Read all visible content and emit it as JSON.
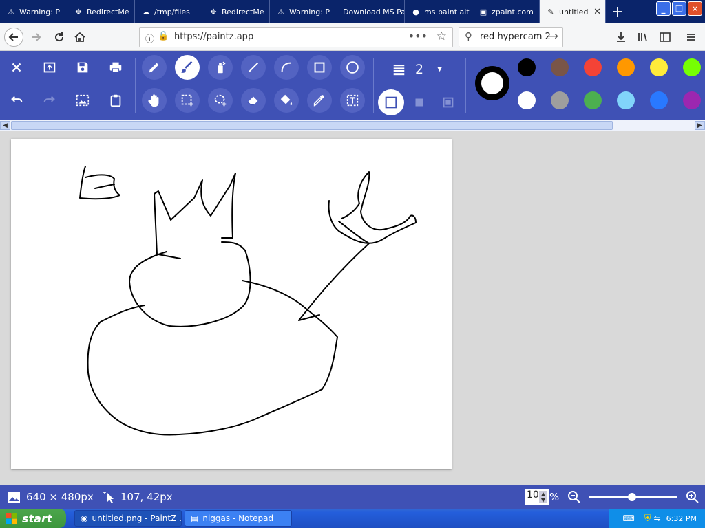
{
  "browser": {
    "tabs": [
      {
        "label": "Warning: P",
        "icon": "warning-icon"
      },
      {
        "label": "RedirectMe",
        "icon": "redirect-icon"
      },
      {
        "label": "/tmp/files",
        "icon": "cloud-icon"
      },
      {
        "label": "RedirectMe",
        "icon": "redirect-icon"
      },
      {
        "label": "Warning: P",
        "icon": "warning-icon"
      },
      {
        "label": "Download MS Pa",
        "icon": "none"
      },
      {
        "label": "ms paint alt",
        "icon": "duckduckgo-icon"
      },
      {
        "label": "zpaint.com",
        "icon": "hd-icon"
      },
      {
        "label": "untitled",
        "icon": "paintz-icon"
      }
    ],
    "url": "https://paintz.app",
    "search": "red hypercam 2"
  },
  "toolbar": {
    "line_width": "2",
    "colors": {
      "row1": [
        "#000000",
        "#795548",
        "#f44336",
        "#ff9800",
        "#ffeb3b",
        "#76ff03"
      ],
      "row2": [
        "#ffffff",
        "#9e9e9e",
        "#4caf50",
        "#81d4fa",
        "#2979ff",
        "#9c27b0"
      ]
    },
    "current_color": "#ffffff"
  },
  "status": {
    "canvas_size": "640 × 480px",
    "cursor_pos": "107, 42px",
    "zoom_value": "10",
    "zoom_unit": "%"
  },
  "taskbar": {
    "start_label": "start",
    "tasks": [
      "untitled.png - PaintZ ...",
      "niggas - Notepad"
    ],
    "clock": "6:32 PM"
  }
}
